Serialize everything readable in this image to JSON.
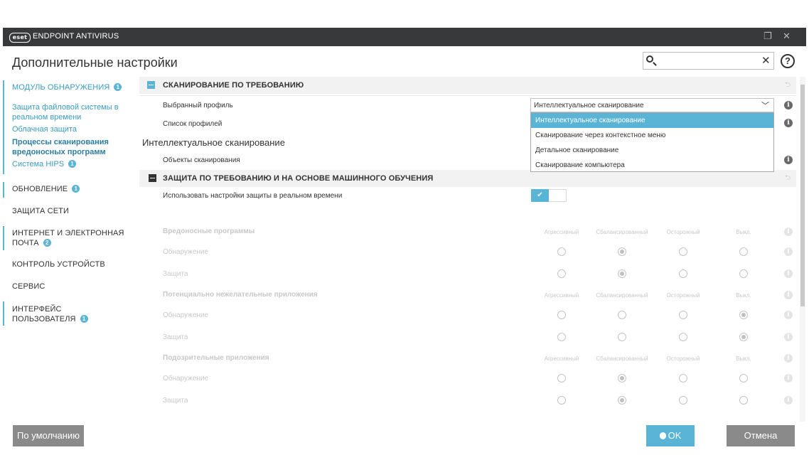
{
  "app": {
    "logo_text": "eset",
    "product_name": "ENDPOINT ANTIVIRUS",
    "page_title": "Дополнительные настройки",
    "search_value": "",
    "restore_glyph": "❐",
    "close_glyph": "✕",
    "clear_glyph": "✕",
    "help_glyph": "?"
  },
  "sidebar": {
    "detection": "МОДУЛЬ ОБНАРУЖЕНИЯ",
    "detection_badge": "1",
    "sub_realtime": "Защита файловой системы в реальном времени",
    "sub_cloud": "Облачная защита",
    "sub_malware_scans": "Процессы сканирования вредоносных программ",
    "sub_hips": "Система HIPS",
    "sub_hips_badge": "1",
    "update": "ОБНОВЛЕНИЕ",
    "update_badge": "1",
    "network": "ЗАЩИТА СЕТИ",
    "web_email": "ИНТЕРНЕТ И ЭЛЕКТРОННАЯ ПОЧТА",
    "web_email_badge": "2",
    "device_control": "КОНТРОЛЬ УСТРОЙСТВ",
    "tools": "СЕРВИС",
    "ui": "ИНТЕРФЕЙС ПОЛЬЗОВАТЕЛЯ",
    "ui_badge": "1"
  },
  "main": {
    "section1_title": "СКАНИРОВАНИЕ ПО ТРЕБОВАНИЮ",
    "selected_profile_label": "Выбранный профиль",
    "profile_list_label": "Список профилей",
    "subheading": "Интеллектуальное сканирование",
    "scan_targets_label": "Объекты сканирования",
    "section2_title": "ЗАЩИТА ПО ТРЕБОВАНИЮ И НА ОСНОВЕ МАШИННОГО ОБУЧЕНИЯ",
    "use_realtime_label": "Использовать настройки защиты в реальном времени",
    "use_realtime_enabled": true,
    "toggle_glyph": "✔",
    "info_glyph": "i",
    "reset_glyph": "⮌"
  },
  "profile_dropdown": {
    "value": "Интеллектуальное сканирование",
    "chevron": "﹀",
    "options": [
      "Интеллектуальное сканирование",
      "Сканирование через контекстное меню",
      "Детальное сканирование",
      "Сканирование компьютера"
    ],
    "selected_index": 0
  },
  "ml_table": {
    "levels": [
      "Агрессивный",
      "Сбалансированный",
      "Осторожный",
      "Выкл."
    ],
    "groups": [
      {
        "title": "Вредоносные программы",
        "rows": [
          {
            "label": "Обнаружение",
            "selected": 1
          },
          {
            "label": "Защита",
            "selected": 1
          }
        ]
      },
      {
        "title": "Потенциально нежелательные приложения",
        "rows": [
          {
            "label": "Обнаружение",
            "selected": 3
          },
          {
            "label": "Защита",
            "selected": 3
          }
        ]
      },
      {
        "title": "Подозрительные приложения",
        "rows": [
          {
            "label": "Обнаружение",
            "selected": 1
          },
          {
            "label": "Защита",
            "selected": 1
          }
        ]
      }
    ]
  },
  "footer": {
    "default_button": "По умолчанию",
    "ok_button": "OK",
    "cancel_button": "Отмена"
  },
  "colors": {
    "accent": "#5ab4d6",
    "titlebar": "#38393b",
    "button_gray": "#8a8a8a"
  }
}
